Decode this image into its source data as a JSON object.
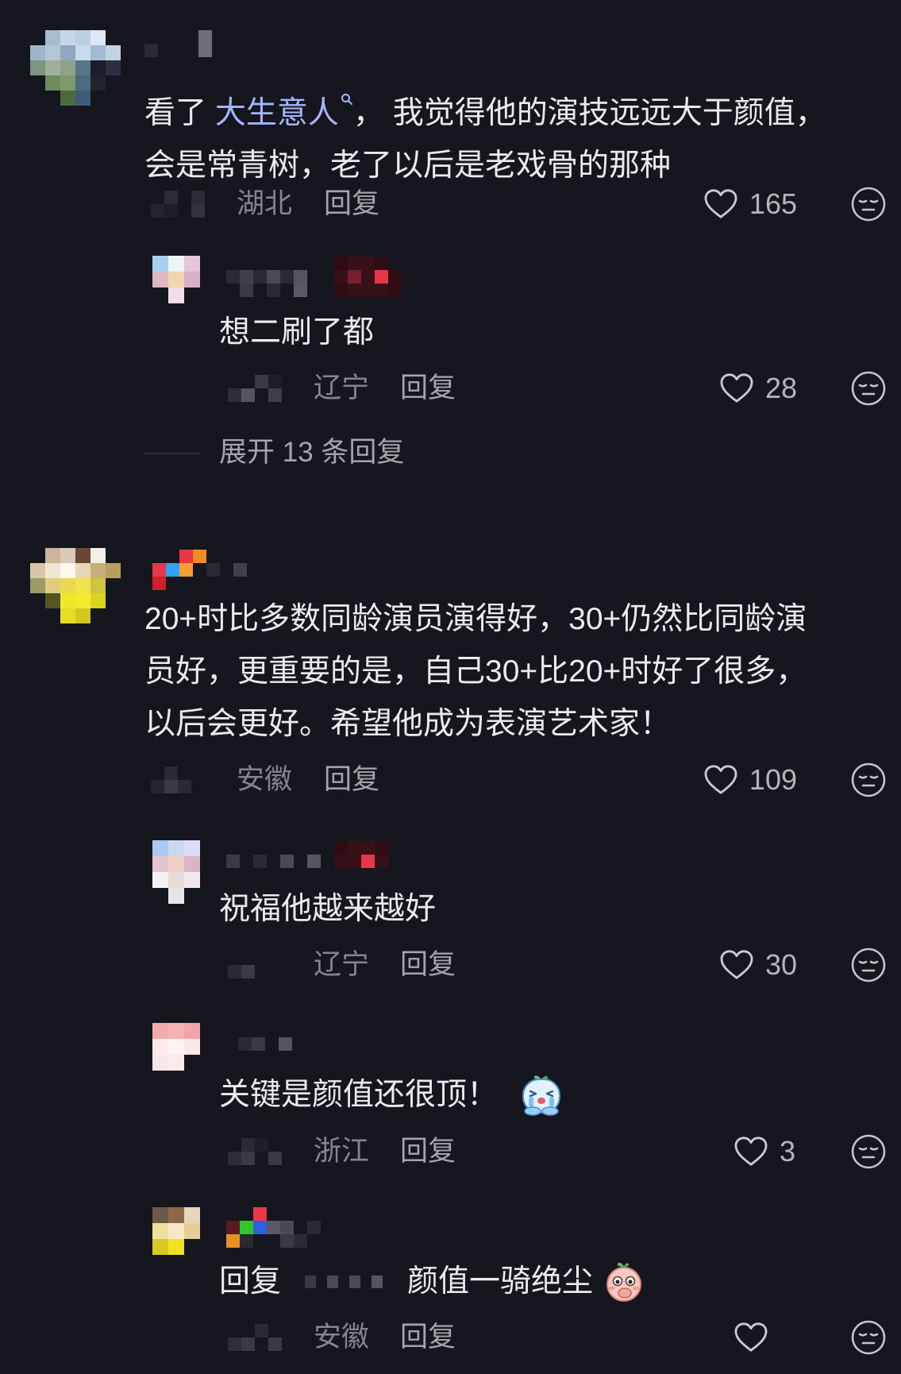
{
  "theme": {
    "background": "#16161e",
    "text_color": "#ebebec",
    "muted_color": "#85858c",
    "link_color": "#a3b5ff"
  },
  "comments": [
    {
      "avatar": [
        [
          null,
          "#a7bccf",
          "#c6d7e6",
          "#b9cfe2",
          "#dbe8f3",
          null
        ],
        [
          "#9fb4c6",
          "#b2c6d8",
          "#8ea9c0",
          "#c9dbea",
          "#a2bbd2",
          "#c0d3e4"
        ],
        [
          "#7f9380",
          "#a1ae9a",
          "#8fa28a",
          "#587488",
          "#1b1e2a",
          "#2a3040"
        ],
        [
          null,
          "#6f8a5e",
          "#7e9a6a",
          "#4a6a80",
          "#202330",
          null
        ],
        [
          null,
          null,
          "#4b6a40",
          "#3f5a78",
          null,
          null
        ]
      ],
      "username": [
        [
          null,
          null,
          null,
          null,
          "#6e6e76"
        ],
        [
          "#2a2a32",
          null,
          null,
          null,
          "#6e6e76"
        ]
      ],
      "text": {
        "prefix": "看了 ",
        "link": "大生意人",
        "link_icon": "search-icon",
        "rest": "， 我觉得他的演技远远大于颜值，",
        "line2": "会是常青树，老了以后是老戏骨的那种"
      },
      "meta": {
        "name": [
          [
            null,
            "#2b2b33",
            null,
            "#2b2b33"
          ],
          [
            "#24242c",
            "#1e1e26",
            null,
            "#33333b"
          ]
        ],
        "location": "湖北",
        "reply_label": "回复",
        "likes": "165",
        "like_icon": "heart-icon",
        "reaction_icon": "emoji-reaction-icon"
      },
      "replies": [
        {
          "avatar": [
            [
              "#a6cff0",
              "#eef3f8",
              "#e6c6d6"
            ],
            [
              "#e0b6c1",
              "#efd6ae",
              "#d9afc7"
            ],
            [
              null,
              "#f0dfe7",
              null
            ]
          ],
          "username": [
            [
              null,
              null,
              null,
              null,
              null,
              null,
              null,
              null,
              "#2e0d13",
              "#38101a",
              "#38101a",
              "#2e0d13",
              null
            ],
            [
              "#2a2a32",
              "#40404a",
              "#2a2a32",
              "#4a4a52",
              "#2a2a32",
              "#55555d",
              null,
              null,
              "#38101a",
              "#7a1d2c",
              "#38101a",
              "#e8374a",
              "#2e0d13"
            ],
            [
              null,
              "#3a3a42",
              null,
              "#2a2a32",
              null,
              "#5a5a62",
              null,
              null,
              "#2e0d13",
              "#38101a",
              "#38101a",
              "#38101a",
              "#2e0d13"
            ]
          ],
          "text": "想二刷了都",
          "meta": {
            "name": [
              [
                null,
                null,
                "#3a3a42",
                "#1e1e26",
                null
              ],
              [
                "#2e2e36",
                "#55555d",
                null,
                "#3e3e46",
                null
              ]
            ],
            "location": "辽宁",
            "reply_label": "回复",
            "likes": "28"
          }
        }
      ],
      "expand_label": "展开 13 条回复"
    },
    {
      "avatar": [
        [
          null,
          "#cbb59a",
          "#d9cbb6",
          "#6a4636",
          "#f3efe7",
          null
        ],
        [
          "#d8c6a6",
          "#efe6d4",
          "#fff9ee",
          "#e7d6b6",
          "#c6b07a",
          "#b5a05e"
        ],
        [
          "#9c9a68",
          "#e0cd7c",
          "#e9da4c",
          "#eee34c",
          "#cfc53c",
          null
        ],
        [
          null,
          "#55551f",
          "#f0e62a",
          "#f4ea2c",
          "#d9d21e",
          null
        ],
        [
          null,
          null,
          "#e8de24",
          "#d0c81c",
          null,
          null
        ]
      ],
      "username": [
        [
          null,
          null,
          "#e8374a",
          "#f08c22",
          null,
          null,
          null
        ],
        [
          "#e8374a",
          "#2ea4f2",
          "#f2a030",
          null,
          "#2a2a32",
          null,
          "#40404a"
        ],
        [
          "#d0202a",
          null,
          null,
          null,
          null,
          null,
          null
        ]
      ],
      "text_lines": [
        "20+时比多数同龄演员演得好，30+仍然比同龄演",
        "员好，更重要的是，自己30+比20+时好了很多，",
        "以后会更好。希望他成为表演艺术家！"
      ],
      "meta": {
        "name": [
          [
            null,
            "#2a2a32",
            null,
            null
          ],
          [
            "#24242c",
            "#3a3a42",
            "#2a2a32",
            null
          ]
        ],
        "location": "安徽",
        "reply_label": "回复",
        "likes": "109"
      },
      "replies": [
        {
          "avatar": [
            [
              "#aac8f0",
              "#c8d8f0",
              "#dcdcf4"
            ],
            [
              "#e6c2d2",
              "#f0d0c4",
              "#d8b4c4"
            ],
            [
              "#f2f2f2",
              "#e8dcd8",
              "#f0e8ec"
            ],
            [
              null,
              "#e6e6e8",
              null
            ]
          ],
          "username": [
            [
              null,
              null,
              null,
              null,
              null,
              null,
              null,
              null,
              "#2e0d13",
              "#38101a",
              "#38101a",
              "#2e0d13"
            ],
            [
              "#3a3a42",
              null,
              "#2a2a32",
              null,
              "#4a4a52",
              null,
              "#55555d",
              null,
              "#38101a",
              "#38101a",
              "#e8374a",
              "#38101a"
            ]
          ],
          "text": "祝福他越来越好",
          "meta": {
            "name": [
              [
                null,
                null,
                null,
                null
              ],
              [
                "#2a2a32",
                "#3a3a42",
                null,
                null
              ]
            ],
            "location": "辽宁",
            "reply_label": "回复",
            "likes": "30"
          }
        },
        {
          "avatar": [
            [
              "#f2aaaa",
              "#f5b2b2",
              "#f2a4aa"
            ],
            [
              "#fde9e9",
              "#fff2f2",
              "#f8e8e8"
            ],
            [
              "#f6e6e8",
              "#fbeaea",
              null
            ]
          ],
          "username": [
            [
              "#2a2a32",
              "#3a3a42",
              null,
              "#55555d"
            ]
          ],
          "text": "关键是颜值还很顶！",
          "emoji": "crying-face-emoji",
          "meta": {
            "name": [
              [
                null,
                "#2a2a32",
                "#1e1e26",
                null
              ],
              [
                "#2e2e36",
                "#3a3a42",
                null,
                "#3a3a42"
              ]
            ],
            "location": "浙江",
            "reply_label": "回复",
            "likes": "3"
          }
        },
        {
          "avatar": [
            [
              "#6b5a4a",
              "#8a6a48",
              "#e6d6be"
            ],
            [
              "#efdf9e",
              "#f7e7c7",
              "#e6cf96"
            ],
            [
              "#d9ca22",
              "#f0e124",
              null
            ]
          ],
          "username": [
            [
              null,
              null,
              "#e8374a",
              null,
              null,
              null,
              null
            ],
            [
              "#5a1a22",
              "#2ec82e",
              "#3060e0",
              "#5a5a62",
              "#4a4a52",
              null,
              "#2a2a32"
            ],
            [
              "#e89020",
              "#2a2a32",
              null,
              null,
              "#3a3a42",
              "#2a2a32",
              null
            ]
          ],
          "reply_prefix": "回复",
          "reply_to": [
            [
              "#3a3a42",
              null,
              "#4a4a52",
              null,
              "#4a4a52",
              null,
              "#555560"
            ]
          ],
          "text": "颜值一骑绝尘",
          "emoji": "peach-face-emoji",
          "meta": {
            "name": [
              [
                null,
                null,
                "#2a2a32",
                null
              ],
              [
                "#2e2e36",
                "#3a3a42",
                null,
                "#3a3a42"
              ]
            ],
            "location": "安徽",
            "reply_label": "回复"
          }
        }
      ]
    }
  ]
}
